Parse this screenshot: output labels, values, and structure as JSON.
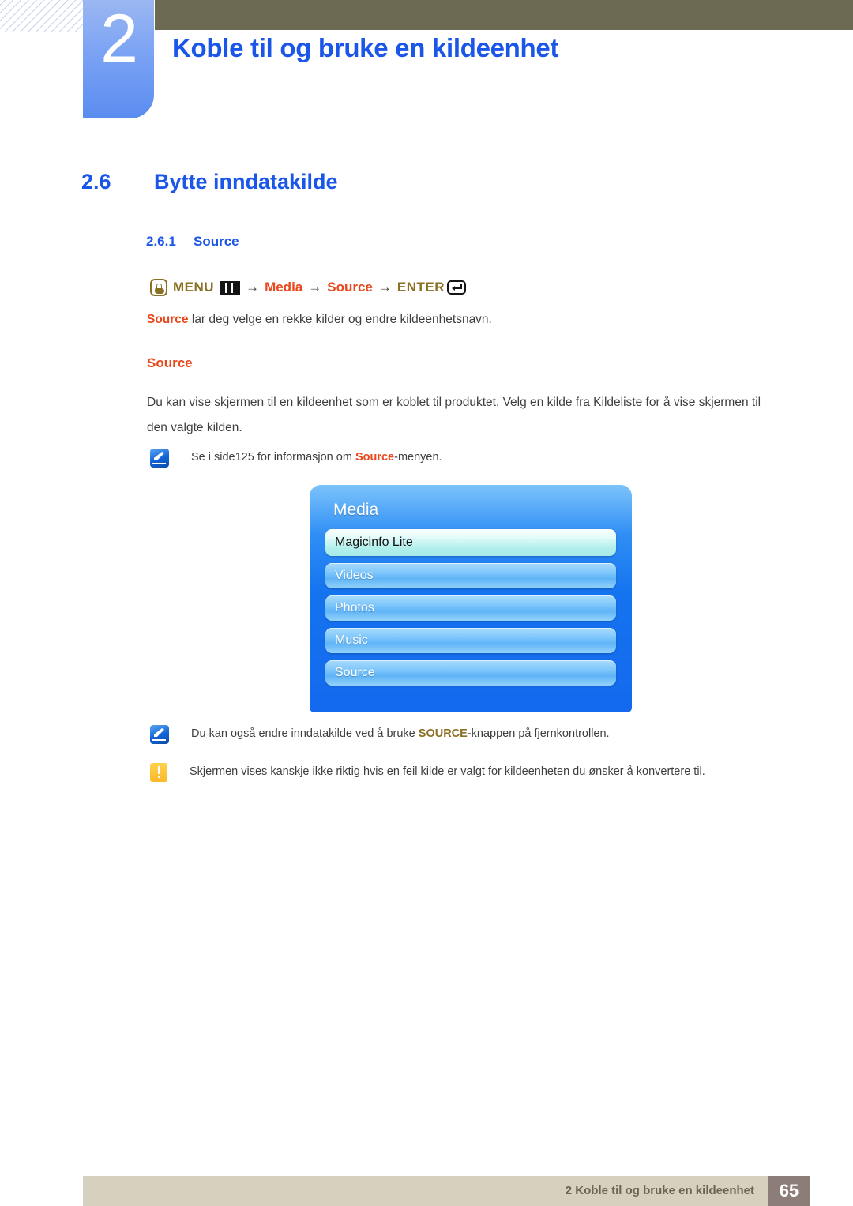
{
  "chapter": {
    "number": "2",
    "title": "Koble til og bruke en kildeenhet"
  },
  "sections": {
    "h2_number": "2.6",
    "h2_title": "Bytte inndatakilde",
    "h3_number": "2.6.1",
    "h3_title": "Source"
  },
  "menu_path": {
    "hand_icon": "hand-touch-icon",
    "menu_label": "MENU",
    "grid_icon": "menu-grid-icon",
    "arrow": "→",
    "media_label": "Media",
    "source_label": "Source",
    "enter_label": "ENTER",
    "enter_icon": "enter-key-icon"
  },
  "body": {
    "lead_keyword": "Source",
    "lead_rest": " lar deg velge en rekke kilder og endre kildeenhetsnavn.",
    "sub_heading": "Source",
    "paragraph": "Du kan vise skjermen til en kildeenhet som er koblet til produktet. Velg en kilde fra Kildeliste for å vise skjermen til den valgte kilden."
  },
  "notes": [
    {
      "icon": "note-pen-icon",
      "text_before": "Se i side125 for informasjon om ",
      "keyword": "Source",
      "keyword_color": "#e8481c",
      "text_after": "-menyen."
    },
    {
      "icon": "note-pen-icon",
      "text_before": "Du kan også endre inndatakilde ved å bruke ",
      "keyword": "SOURCE",
      "keyword_color": "#8a7023",
      "text_after": "-knappen på fjernkontrollen."
    },
    {
      "icon": "caution-icon",
      "text_before": "Skjermen vises kanskje ikke riktig hvis en feil kilde er valgt for kildeenheten du ønsker å konvertere til.",
      "keyword": "",
      "keyword_color": "",
      "text_after": ""
    }
  ],
  "osd": {
    "title": "Media",
    "items": [
      {
        "label": "Magicinfo Lite",
        "selected": true
      },
      {
        "label": "Videos",
        "selected": false
      },
      {
        "label": "Photos",
        "selected": false
      },
      {
        "label": "Music",
        "selected": false
      },
      {
        "label": "Source",
        "selected": false
      }
    ]
  },
  "footer": {
    "text": "2 Koble til og bruke en kildeenhet",
    "page": "65"
  },
  "colors": {
    "heading_blue": "#1a56e8",
    "keyword_red": "#e8481c",
    "keyword_gold": "#8a7023",
    "khaki": "#6d6a54",
    "footer_bar": "#d6d1be",
    "footer_page": "#8d7d78",
    "osd_blue": "#1473ef"
  }
}
